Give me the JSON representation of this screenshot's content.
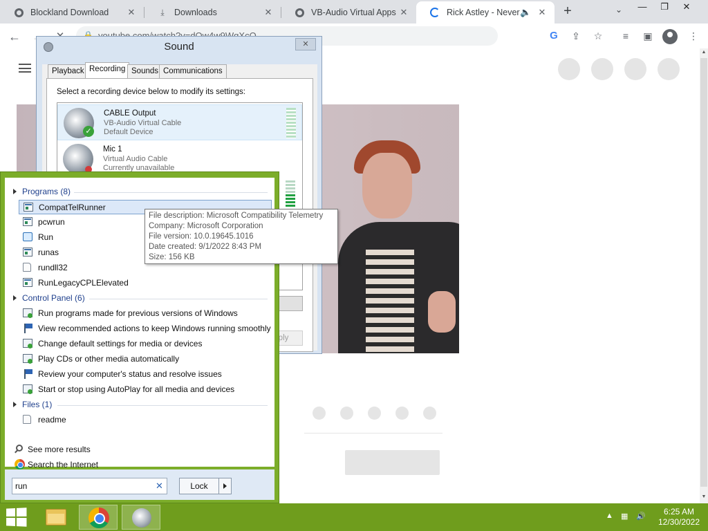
{
  "browser": {
    "tabs": [
      {
        "label": "Blockland Download",
        "icon": "globe-icon"
      },
      {
        "label": "Downloads",
        "icon": "download-icon"
      },
      {
        "label": "VB-Audio Virtual Apps",
        "icon": "globe-icon"
      },
      {
        "label": "Rick Astley - Never G",
        "icon": "loading-spinner-icon",
        "active": true
      }
    ],
    "url": "youtube.com/watch?v=dQw4w9WgXcQ",
    "accent_color": "#1a73e8"
  },
  "sound_dialog": {
    "title": "Sound",
    "tabs": [
      "Playback",
      "Recording",
      "Sounds",
      "Communications"
    ],
    "selected_tab": "Recording",
    "instruction": "Select a recording device below to modify its settings:",
    "devices": [
      {
        "name": "CABLE Output",
        "driver": "VB-Audio Virtual Cable",
        "status": "Default Device"
      },
      {
        "name": "Mic 1",
        "driver": "Virtual Audio Cable",
        "status": "Currently unavailable"
      }
    ],
    "properties_partial": "rties",
    "apply_label": "Apply"
  },
  "start_menu": {
    "groups": [
      {
        "title": "Programs (8)",
        "items": [
          "CompatTelRunner",
          "pcwrun",
          "Run",
          "runas",
          "rundll32",
          "RunLegacyCPLElevated"
        ]
      },
      {
        "title": "Control Panel (6)",
        "items": [
          "Run programs made for previous versions of Windows",
          "View recommended actions to keep Windows running smoothly",
          "Change default settings for media or devices",
          "Play CDs or other media automatically",
          "Review your computer's status and resolve issues",
          "Start or stop using AutoPlay for all media and devices"
        ]
      },
      {
        "title": "Files (1)",
        "items": [
          "readme"
        ]
      }
    ],
    "see_more": "See more results",
    "search_internet": "Search the Internet",
    "search_value": "run",
    "lock_label": "Lock",
    "theme_color": "#7cad2a"
  },
  "tooltip": {
    "lines": [
      "File description: Microsoft Compatibility Telemetry",
      "Company: Microsoft Corporation",
      "File version: 10.0.19645.1016",
      "Date created: 9/1/2022 8:43 PM",
      "Size: 156 KB"
    ]
  },
  "taskbar": {
    "time": "6:25 AM",
    "date": "12/30/2022",
    "color": "#6f9d1d"
  }
}
